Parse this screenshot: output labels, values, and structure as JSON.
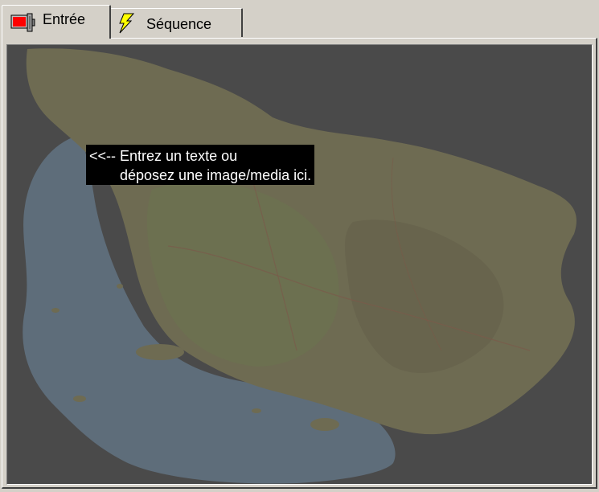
{
  "tabs": [
    {
      "label": "Entrée",
      "icon": "input-device-icon",
      "active": true
    },
    {
      "label": "Séquence",
      "icon": "lightning-icon",
      "active": false
    }
  ],
  "drop_area": {
    "hint_line1": "<<-- Entrez un texte ou",
    "hint_line2": "déposez une image/media ici.",
    "map_icon": "map-image"
  },
  "colors": {
    "chrome": "#d4d0c8",
    "viewport_bg": "#4a4a4a",
    "sea": "#5f6f7c",
    "land": "#6e6b52",
    "hint_bg": "#000000",
    "hint_text": "#ffffff"
  }
}
